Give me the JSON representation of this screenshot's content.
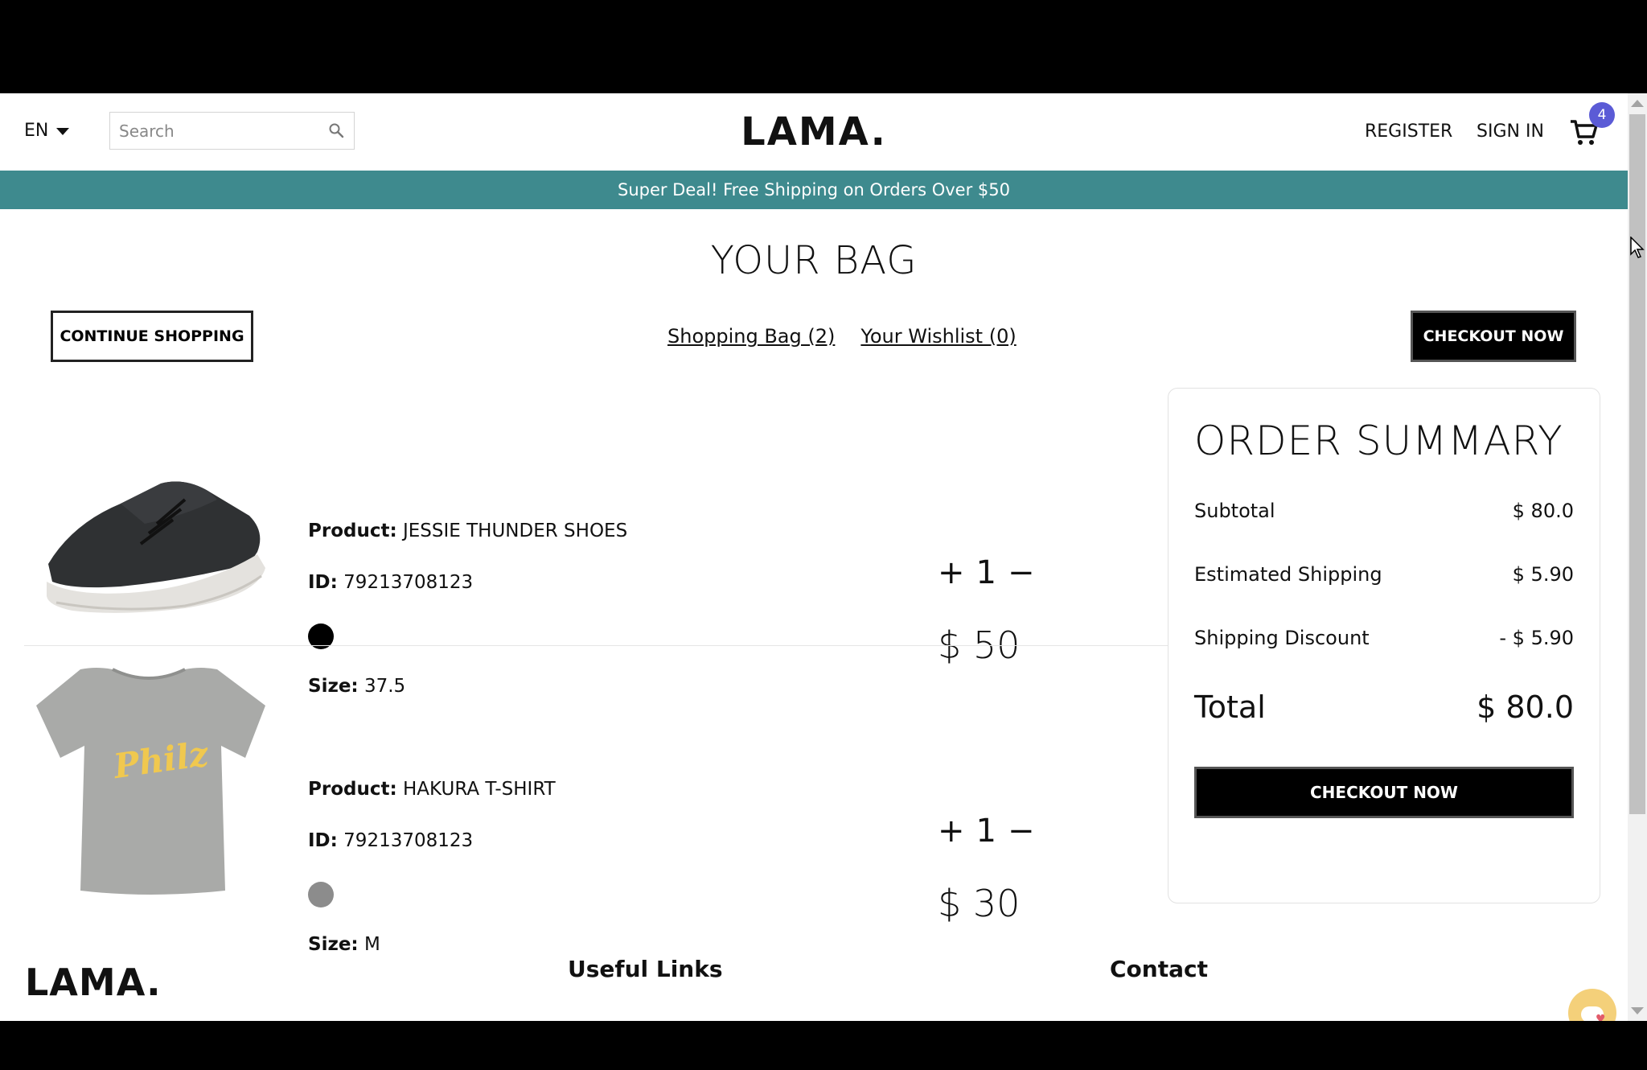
{
  "nav": {
    "language": "EN",
    "search_placeholder": "Search",
    "logo": "LAMA.",
    "register": "REGISTER",
    "sign_in": "SIGN IN",
    "cart_count": "4"
  },
  "announcement": "Super Deal! Free Shipping on Orders Over $50",
  "bag": {
    "title": "YOUR BAG",
    "continue_shopping": "CONTINUE SHOPPING",
    "shopping_bag_tab": "Shopping Bag (2)",
    "wishlist_tab": "Your Wishlist (0)",
    "checkout_top": "CHECKOUT NOW"
  },
  "labels": {
    "product": "Product:",
    "id": "ID:",
    "size": "Size:",
    "plus": "+",
    "minus": "−"
  },
  "products": [
    {
      "name": "JESSIE THUNDER SHOES",
      "id": "79213708123",
      "color": "#000000",
      "size": "37.5",
      "quantity": "1",
      "price": "$ 50",
      "image_icon": "sneaker-image"
    },
    {
      "name": "HAKURA T-SHIRT",
      "id": "79213708123",
      "color": "#8c8c8c",
      "size": "M",
      "quantity": "1",
      "price": "$ 30",
      "image_icon": "tshirt-image",
      "print_text": "Philz"
    }
  ],
  "summary": {
    "title": "ORDER SUMMARY",
    "subtotal_label": "Subtotal",
    "subtotal_value": "$ 80.0",
    "shipping_label": "Estimated Shipping",
    "shipping_value": "$ 5.90",
    "discount_label": "Shipping Discount",
    "discount_value": "- $ 5.90",
    "total_label": "Total",
    "total_value": "$ 80.0",
    "checkout": "CHECKOUT NOW"
  },
  "footer": {
    "logo": "LAMA.",
    "useful_links": "Useful Links",
    "contact": "Contact"
  },
  "colors": {
    "announcement_bg": "#3e8a8e",
    "badge": "#5b5bd6",
    "button_dark": "#000000"
  }
}
